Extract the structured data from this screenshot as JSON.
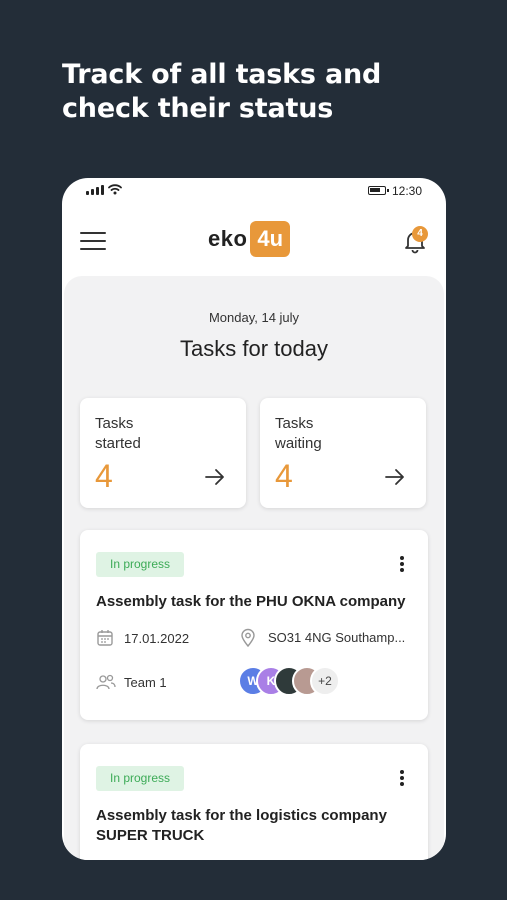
{
  "headline": {
    "line1": "Track of all tasks and",
    "line2": "check their status"
  },
  "status_bar": {
    "time": "12:30",
    "icons": [
      "signal-icon",
      "wifi-icon",
      "battery-icon"
    ]
  },
  "app_bar": {
    "menu_icon": "hamburger-menu-icon",
    "logo_text": "eko",
    "logo_badge": "4u",
    "notification_icon": "bell-icon",
    "notification_count": "4",
    "accent_color": "#e8983a"
  },
  "main": {
    "date": "Monday, 14 july",
    "title": "Tasks for today",
    "stats": [
      {
        "label_line1": "Tasks",
        "label_line2": "started",
        "count": "4",
        "icon": "arrow-right-icon"
      },
      {
        "label_line1": "Tasks",
        "label_line2": "waiting",
        "count": "4",
        "icon": "arrow-right-icon"
      }
    ],
    "tasks": [
      {
        "status": "In progress",
        "title_line1": "Assembly task for the PHU OKNA company",
        "title_line2": "",
        "date": "17.01.2022",
        "location": "SO31 4NG Southamp...",
        "team": "Team 1",
        "avatars": [
          "W",
          "K",
          "",
          ""
        ],
        "more_count": "+2"
      },
      {
        "status": "In progress",
        "title_line1": "Assembly task for the logistics company",
        "title_line2": "SUPER TRUCK"
      }
    ],
    "status_colors": {
      "in_progress_bg": "#dff3e4",
      "in_progress_text": "#3dab57"
    }
  }
}
